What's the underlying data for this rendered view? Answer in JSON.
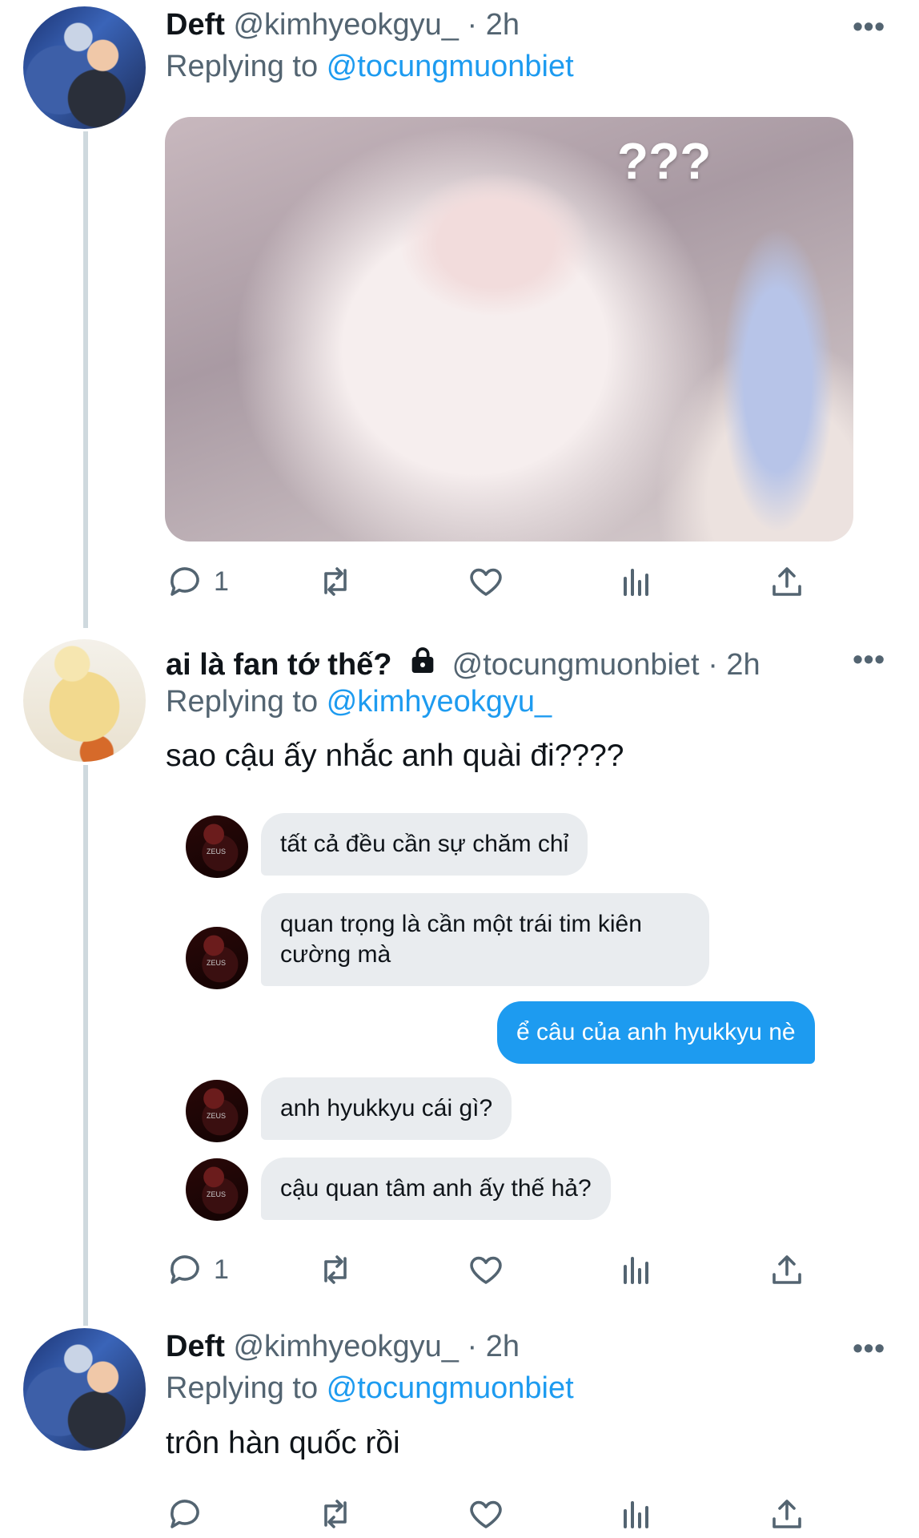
{
  "tweets": [
    {
      "name": "Deft",
      "handle": "@kimhyeokgyu_",
      "time": "· 2h",
      "reply_prefix": "Replying to",
      "reply_to": "@tocungmuonbiet",
      "media_text": "???",
      "reply_count": "1"
    },
    {
      "name": "ai là fan tớ thế?",
      "handle": "@tocungmuonbiet",
      "time": "· 2h",
      "reply_prefix": "Replying to",
      "reply_to": "@kimhyeokgyu_",
      "text": "sao cậu ấy nhắc anh quài đi????",
      "reply_count": "1",
      "chat": [
        {
          "text": "tất cả đều cần sự chăm chỉ",
          "from": "other"
        },
        {
          "text": "quan trọng là cần một trái tim kiên cường mà",
          "from": "other"
        },
        {
          "text": "ể câu của anh hyukkyu nè",
          "from": "me"
        },
        {
          "text": "anh hyukkyu cái gì?",
          "from": "other"
        },
        {
          "text": "cậu quan tâm anh ấy thế hả?",
          "from": "other"
        }
      ]
    },
    {
      "name": "Deft",
      "handle": "@kimhyeokgyu_",
      "time": "· 2h",
      "reply_prefix": "Replying to",
      "reply_to": "@tocungmuonbiet",
      "text": "trôn hàn quốc rồi"
    }
  ],
  "colors": {
    "accent": "#1d9bf0",
    "muted": "#536471",
    "text": "#0f1419",
    "bubble": "#e9ecef"
  }
}
